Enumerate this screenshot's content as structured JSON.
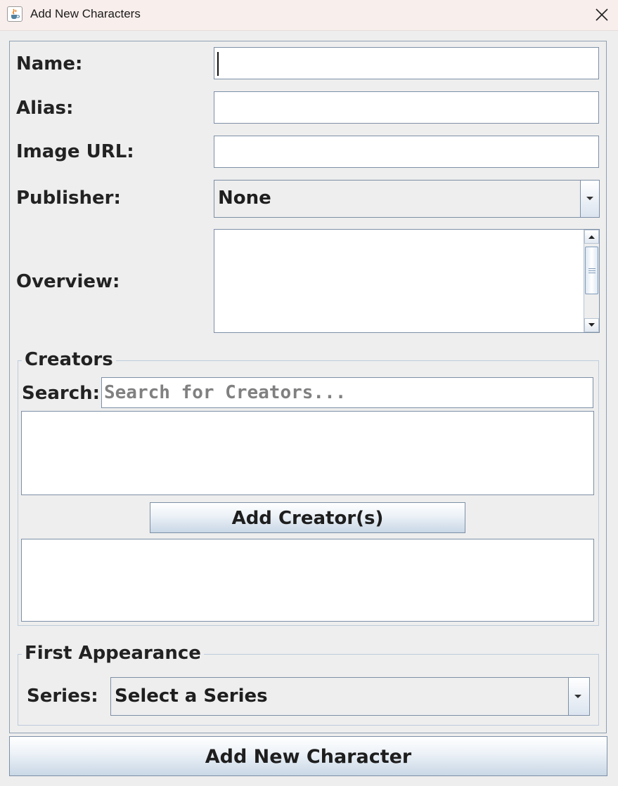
{
  "window": {
    "title": "Add New Characters",
    "icon": "java-cup-icon",
    "close_icon": "close-icon"
  },
  "form": {
    "name_label": "Name:",
    "name_value": "",
    "alias_label": "Alias:",
    "alias_value": "",
    "image_url_label": "Image URL:",
    "image_url_value": "",
    "publisher_label": "Publisher:",
    "publisher_selected": "None",
    "overview_label": "Overview:",
    "overview_value": ""
  },
  "creators": {
    "group_title": "Creators",
    "search_label": "Search:",
    "search_placeholder": "Search for Creators...",
    "search_value": "",
    "results": [],
    "selected": [],
    "add_button_label": "Add Creator(s)"
  },
  "first_appearance": {
    "group_title": "First Appearance",
    "series_label": "Series:",
    "series_selected": "Select a Series"
  },
  "actions": {
    "submit_label": "Add New Character"
  },
  "colors": {
    "title_bar": "#f8eeec",
    "panel_border": "#8e9fb2",
    "button_gradient_end": "#c9d7e6"
  }
}
